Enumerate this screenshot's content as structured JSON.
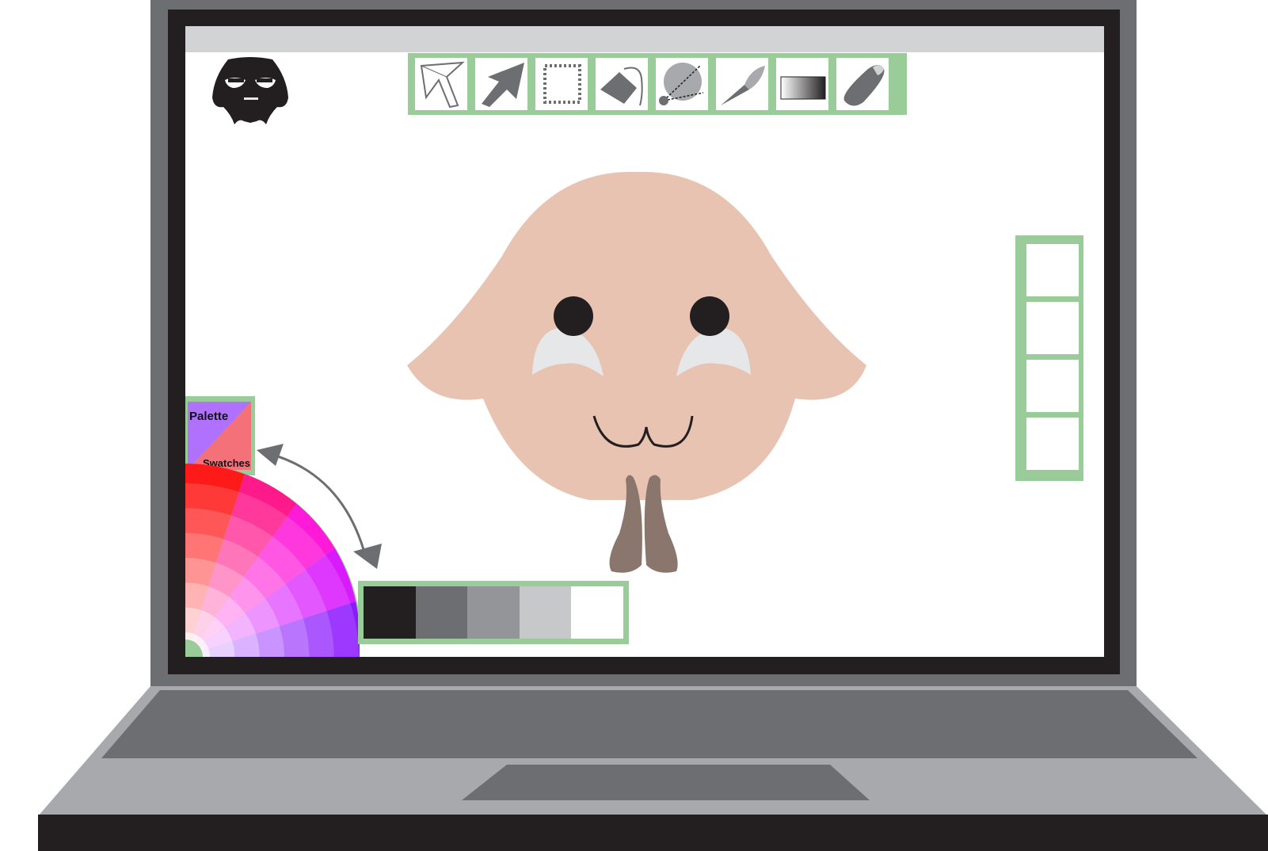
{
  "app": {
    "name": "paint-app-mockup"
  },
  "colors": {
    "laptop_frame": "#6d6e71",
    "bezel": "#231f20",
    "base_body": "#a7a9ac",
    "keyboard_area": "#6d6e71",
    "base_front": "#231f20",
    "title_bar": "#d1d3d4",
    "canvas": "#ffffff",
    "panel_accent": "#99cc99",
    "icon_gray": "#6d6e71",
    "arrow_gray": "#6d6e71",
    "mascot_skin": "#e8c3b2",
    "mascot_eye_white": "#e6e7e8",
    "mascot_mustache": "#8a766d",
    "avatar": "#231f20"
  },
  "toolbar": {
    "tools": [
      {
        "name": "select-arrow",
        "icon": "outline-arrow-icon"
      },
      {
        "name": "direct-select",
        "icon": "solid-arrow-icon"
      },
      {
        "name": "marquee",
        "icon": "marquee-icon"
      },
      {
        "name": "paint-bucket",
        "icon": "paint-bucket-icon"
      },
      {
        "name": "eyedropper-sphere",
        "icon": "sphere-picker-icon"
      },
      {
        "name": "brush",
        "icon": "brush-icon"
      },
      {
        "name": "gradient",
        "icon": "gradient-icon"
      },
      {
        "name": "eraser",
        "icon": "eraser-icon"
      }
    ]
  },
  "palette_toggle": {
    "palette_label": "Palette",
    "swatches_label": "Swatches",
    "palette_color": "#b071ff",
    "swatches_color": "#f5717a"
  },
  "swatches": {
    "colors": [
      "#231f20",
      "#6d6e71",
      "#939598",
      "#c7c8ca",
      "#ffffff"
    ]
  },
  "layers": {
    "slots": 4
  },
  "user": {
    "avatar_icon": "mask-avatar-icon"
  }
}
